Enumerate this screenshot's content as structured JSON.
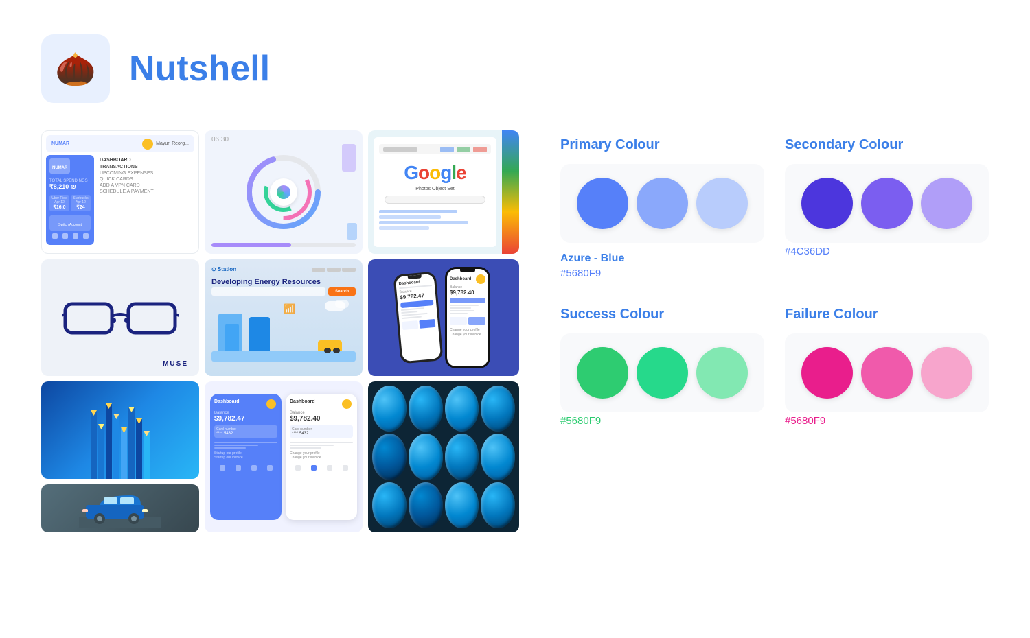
{
  "header": {
    "logo_emoji": "🌰",
    "app_name": "Nutshell"
  },
  "palette": {
    "primary": {
      "label": "Primary Colour",
      "name": "Azure - Blue",
      "hex": "#5680F9",
      "colors": [
        "#5680F9",
        "#8aa8fb",
        "#b8ccfc"
      ]
    },
    "secondary": {
      "label": "Secondary Colour",
      "hex": "#4C36DD",
      "colors": [
        "#4C36DD",
        "#7b5ef0",
        "#b09ef8"
      ]
    },
    "success": {
      "label": "Success Colour",
      "hex": "#5680F9",
      "colors": [
        "#2ecc71",
        "#26d98b",
        "#82e8b2"
      ]
    },
    "failure": {
      "label": "Failure Colour",
      "hex": "#5680F9",
      "colors": [
        "#e91e8c",
        "#f05aab",
        "#f7a5cc"
      ]
    }
  },
  "finance": {
    "title": "Numar",
    "balance_label": "TOTAL SPENDINGS",
    "balance": "₹8,210 ₪",
    "card1_label": "Uber Ride",
    "card1_date": "Apr 12",
    "card1_amount": "₹16.0",
    "card2_label": "Starbucks",
    "card2_date": "Apr 12",
    "card2_amount": "₹24",
    "menu_items": [
      "DASHBOARD",
      "TRANSACTIONS",
      "UPCOMING EXPENSES",
      "QUICK CARDS",
      "SCHEDULE A PAYMENT"
    ],
    "footer": "Switch Account"
  },
  "wheel": {
    "time": "06:30"
  },
  "energy": {
    "title": "Station",
    "heading": "Developing Energy Resources",
    "button": "Search"
  },
  "dashboard": {
    "title1": "Dashboard",
    "balance1": "$9,782.47",
    "title2": "Dashboard",
    "balance2": "$9,782.40"
  }
}
